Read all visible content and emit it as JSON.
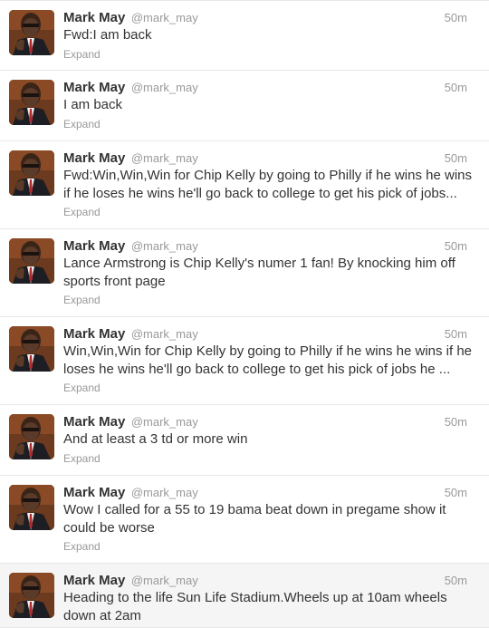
{
  "tweets": [
    {
      "name": "Mark May",
      "handle": "@mark_may",
      "time": "50m",
      "text": "Fwd:I am back",
      "expand": "Expand"
    },
    {
      "name": "Mark May",
      "handle": "@mark_may",
      "time": "50m",
      "text": "I am back",
      "expand": "Expand"
    },
    {
      "name": "Mark May",
      "handle": "@mark_may",
      "time": "50m",
      "text": "Fwd:Win,Win,Win for Chip Kelly by going to Philly if he wins he wins\nif he loses he wins he'll go back to college to get his pick of jobs...",
      "expand": "Expand"
    },
    {
      "name": "Mark May",
      "handle": "@mark_may",
      "time": "50m",
      "text": "Lance Armstrong is Chip Kelly's numer 1 fan! By knocking him off\nsports front page",
      "expand": "Expand"
    },
    {
      "name": "Mark May",
      "handle": "@mark_may",
      "time": "50m",
      "text": "Win,Win,Win for Chip Kelly by going to Philly if he wins he wins if he\nloses he wins he'll go back to college to get his pick of jobs he ...",
      "expand": "Expand"
    },
    {
      "name": "Mark May",
      "handle": "@mark_may",
      "time": "50m",
      "text": "And at least a 3 td or more win",
      "expand": "Expand"
    },
    {
      "name": "Mark May",
      "handle": "@mark_may",
      "time": "50m",
      "text": "Wow I called for a 55 to 19 bama beat down in pregame show it\ncould be worse",
      "expand": "Expand"
    },
    {
      "name": "Mark May",
      "handle": "@mark_may",
      "time": "50m",
      "text": "Heading to the life Sun Life Stadium.Wheels up at 10am wheels\ndown at 2am",
      "expand": ""
    }
  ]
}
